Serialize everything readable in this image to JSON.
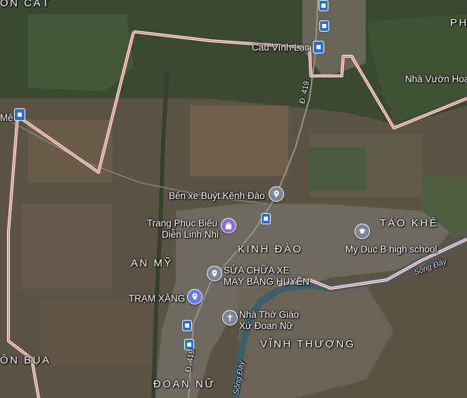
{
  "map": {
    "type": "satellite",
    "boundary_color": "#f07a7a"
  },
  "places": {
    "top_left": "ÔN CÁT",
    "top_right": "PH",
    "an_my": "AN MỸ",
    "kinh_dao": "KINH ĐÀO",
    "tao_khe": "TÁO KHÊ",
    "vinh_thuong": "VĨNH THƯỢNG",
    "on_bua": "ÔN BỤA",
    "doan_nu": "ĐOAN NỮ"
  },
  "pois": {
    "cau_vinh_lac": "Cầu Vĩnh Lạc",
    "nha_vuon": "Nhà Vườn Hoa",
    "me": "Mê",
    "ben_xe": "Bến xe Buýt Kênh Đào",
    "trang_phuc_1": "Trang Phục Biểu",
    "trang_phuc_2": "Diễn Linh Nhi",
    "my_duc": "My Duc B high school",
    "sua_chua_1": "SỬA CHỮA XE",
    "sua_chua_2": "MÁY BẰNG HUYỀN",
    "tram_xang": "TRẠM XĂNG",
    "nha_tho_1": "Nhà Thờ Giáo",
    "nha_tho_2": "Xứ Đoan Nữ"
  },
  "roads": {
    "d419_north": "Đ. 419",
    "d419_south": "Đ. 419"
  },
  "rivers": {
    "song_day_east": "Sông Đáy",
    "song_day_south": "Sông Đáy"
  },
  "icons": {
    "pin_marker": "location-pin-icon",
    "bus_stop": "bus-stop-icon",
    "bus_station": "bus-station-icon",
    "shop": "shopping-bag-icon",
    "school": "graduation-cap-icon",
    "church": "cross-icon"
  }
}
